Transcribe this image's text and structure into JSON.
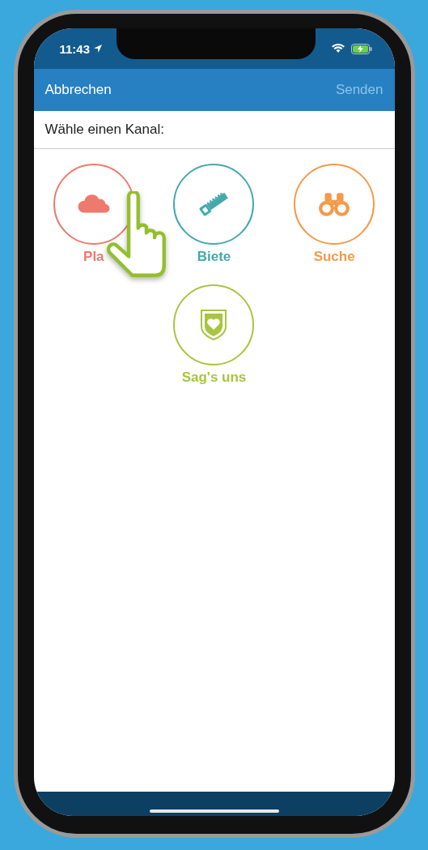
{
  "status_bar": {
    "time": "11:43"
  },
  "nav_bar": {
    "left": "Abbrechen",
    "right": "Senden",
    "right_disabled": true
  },
  "prompt": "Wähle einen Kanal:",
  "channels": [
    {
      "label": "Pla",
      "kind": "cloud",
      "color": "#ee7a6e"
    },
    {
      "label": "Biete",
      "kind": "saw",
      "color": "#45a9ac"
    },
    {
      "label": "Suche",
      "kind": "binoculars",
      "color": "#f59a4a"
    },
    {
      "label": "Sag's uns",
      "kind": "shield",
      "color": "#a9c43f"
    }
  ]
}
